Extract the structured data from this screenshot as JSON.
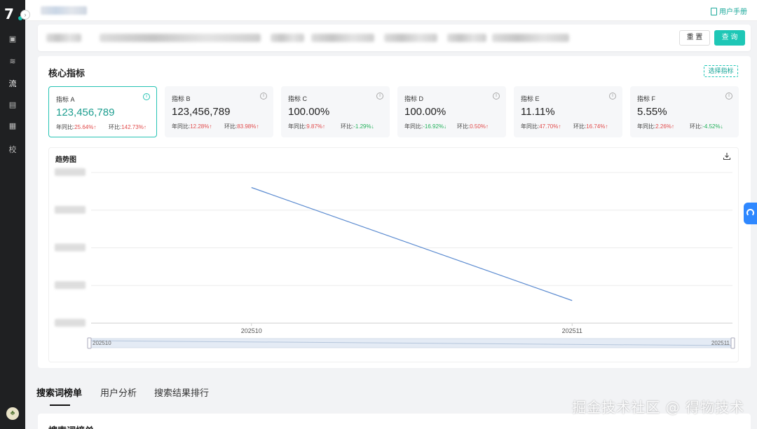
{
  "sidebar": {
    "logo_text": "7",
    "collapse_glyph": "›",
    "items": [
      {
        "icon": "grid-icon",
        "glyph": "▣"
      },
      {
        "icon": "layers-icon",
        "glyph": "≋"
      },
      {
        "icon": "flow-icon",
        "glyph": "流"
      },
      {
        "icon": "report-icon",
        "glyph": "▤"
      },
      {
        "icon": "table-icon",
        "glyph": "▦"
      },
      {
        "icon": "school-icon",
        "glyph": "校"
      }
    ],
    "avatar_glyph": "♣"
  },
  "topbar": {
    "manual_label": "用户手册"
  },
  "filters": {
    "reset_label": "重 置",
    "query_label": "查 询"
  },
  "core": {
    "title": "核心指标",
    "select_label": "选择指标",
    "metrics": [
      {
        "name": "指标 A",
        "value": "123,456,789",
        "yoy_label": "年同比:",
        "yoy": "25.64%↑",
        "yoy_dir": "up",
        "mom_label": "环比:",
        "mom": "142.73%↑",
        "mom_dir": "up",
        "active": true
      },
      {
        "name": "指标 B",
        "value": "123,456,789",
        "yoy_label": "年同比:",
        "yoy": "12.28%↑",
        "yoy_dir": "up",
        "mom_label": "环比:",
        "mom": "83.98%↑",
        "mom_dir": "up",
        "active": false
      },
      {
        "name": "指标 C",
        "value": "100.00%",
        "yoy_label": "年同比:",
        "yoy": "9.87%↑",
        "yoy_dir": "up",
        "mom_label": "环比:",
        "mom": "-1.29%↓",
        "mom_dir": "down",
        "active": false
      },
      {
        "name": "指标 D",
        "value": "100.00%",
        "yoy_label": "年同比:",
        "yoy": "-16.92%↓",
        "yoy_dir": "down",
        "mom_label": "环比:",
        "mom": "0.50%↑",
        "mom_dir": "up",
        "active": false
      },
      {
        "name": "指标 E",
        "value": "11.11%",
        "yoy_label": "年同比:",
        "yoy": "47.70%↑",
        "yoy_dir": "up",
        "mom_label": "环比:",
        "mom": "16.74%↑",
        "mom_dir": "up",
        "active": false
      },
      {
        "name": "指标 F",
        "value": "5.55%",
        "yoy_label": "年同比:",
        "yoy": "2.26%↑",
        "yoy_dir": "up",
        "mom_label": "环比:",
        "mom": "-4.52%↓",
        "mom_dir": "down",
        "active": false
      }
    ]
  },
  "trend": {
    "title": "趋势图"
  },
  "chart_data": {
    "type": "line",
    "categories": [
      "202510",
      "202511"
    ],
    "values": [
      0.9,
      0.15
    ],
    "ylim": [
      0,
      1
    ],
    "grid": true,
    "zoom_range": [
      "202510",
      "202511"
    ],
    "color": "#5b8bd0"
  },
  "tabs": [
    {
      "label": "搜索词榜单",
      "active": true
    },
    {
      "label": "用户分析",
      "active": false
    },
    {
      "label": "搜索结果排行",
      "active": false
    }
  ],
  "bottom": {
    "title": "搜索词榜单"
  },
  "watermark": "掘金技术社区 @ 得物技术"
}
